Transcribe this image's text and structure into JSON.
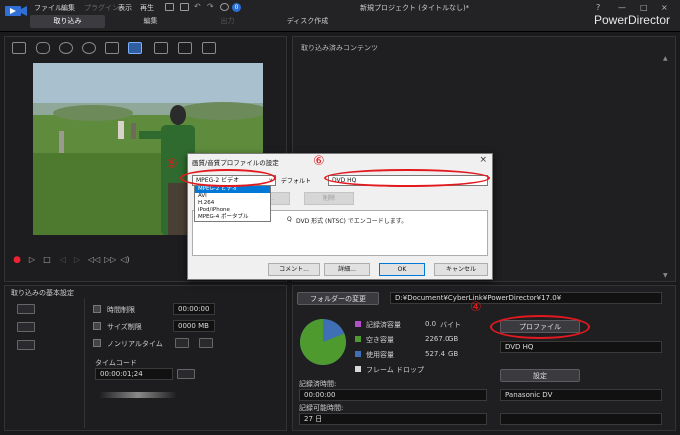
{
  "menu": {
    "file": "ファイル",
    "edit": "編集",
    "plugins": "プラグイン",
    "view": "表示",
    "playback": "再生"
  },
  "notification_count": "0",
  "document_title": "新規プロジェクト (タイトルなし)*",
  "brand": "PowerDirector",
  "window_controls": {
    "help": "?",
    "minimize": "—",
    "maximize": "□",
    "close": "×"
  },
  "mode_tabs": [
    "取り込み",
    "編集",
    "出力",
    "ディスク作成"
  ],
  "imported_content_title": "取り込み済みコンテンツ",
  "capture_settings": {
    "title": "取り込みの基本設定",
    "time_limit_label": "時間制限",
    "time_limit_value": "00:00:00",
    "size_limit_label": "サイズ制限",
    "size_limit_value": "0000",
    "size_limit_unit": "MB",
    "nonreal_label": "ノンリアルタイム",
    "timecode_label": "タイムコード",
    "timecode_value": "00:00:01;24"
  },
  "folder": {
    "button": "フォルダーの変更",
    "path": "D:¥Document¥CyberLink¥PowerDirector¥17.0¥"
  },
  "disk": {
    "recorded_label": "記録済容量",
    "recorded_value": "0.0",
    "recorded_unit": "バイト",
    "free_label": "空き容量",
    "free_value": "2267.0",
    "free_unit": "GB",
    "used_label": "使用容量",
    "used_value": "527.4",
    "used_unit": "GB",
    "dropped_label": "フレーム ドロップ",
    "rec_time_label": "記録済時間:",
    "rec_time_value": "00:00:00",
    "rec_avail_label": "記録可能時間:",
    "rec_avail_value": "27 日",
    "colors": {
      "recorded": "#b24fc9",
      "free": "#4e9a2f",
      "used": "#3f6fb5",
      "dropped": "#d8d8d8"
    },
    "pie_used_fraction": 0.19
  },
  "profile": {
    "button": "プロファイル",
    "value": "DVD HQ",
    "settings_button": "設定",
    "device": "Panasonic DV"
  },
  "dialog": {
    "title": "画質/音質プロファイルの設定",
    "close": "×",
    "format_selected": "MPEG-2 ビデオ",
    "format_options": [
      "MPEG-2 ビデオ",
      "AVI",
      "H.264",
      "iPod/iPhone",
      "MPEG-4 ポータブル"
    ],
    "default_label": "デフォルト",
    "profile_selected": "DVD HQ",
    "new_button": "新規...",
    "delete_button": "削除",
    "description_prefix": "Q",
    "description": "DVD 形式 (NTSC) でエンコードします。",
    "comment_button": "コメント...",
    "detail_button": "詳細...",
    "ok_button": "OK",
    "cancel_button": "キャンセル"
  },
  "annotations": {
    "a4": "④",
    "a5": "⑤",
    "a6": "⑥"
  }
}
